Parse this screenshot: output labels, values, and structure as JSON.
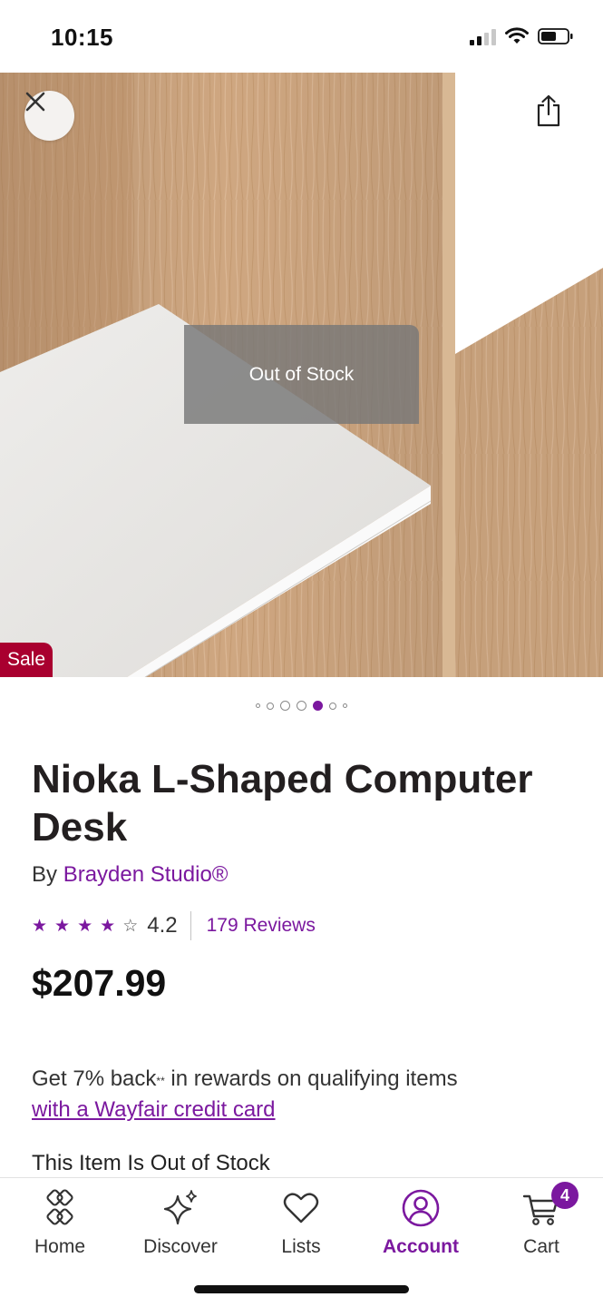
{
  "status_bar": {
    "time": "10:15"
  },
  "hero": {
    "overlay_text": "Out of Stock",
    "sale_badge": "Sale",
    "close_icon": "close-icon",
    "share_icon": "share-icon",
    "carousel": {
      "count": 7,
      "active_index": 4
    }
  },
  "product": {
    "title": "Nioka L-Shaped Computer Desk",
    "by_label": "By",
    "brand": "Brayden Studio®",
    "rating": "4.2",
    "rating_value": 4.2,
    "reviews": "179 Reviews",
    "price": "$207.99",
    "rewards_text": "Get 7% back",
    "rewards_mark": "**",
    "rewards_suffix": " in rewards on qualifying items",
    "rewards_link": "with a Wayfair credit card",
    "stock_note": "This Item Is Out of Stock"
  },
  "nav": {
    "items": [
      {
        "label": "Home",
        "icon": "home-icon"
      },
      {
        "label": "Discover",
        "icon": "sparkle-icon"
      },
      {
        "label": "Lists",
        "icon": "heart-icon"
      },
      {
        "label": "Account",
        "icon": "account-icon",
        "active": true
      },
      {
        "label": "Cart",
        "icon": "cart-icon",
        "badge": "4"
      }
    ]
  },
  "colors": {
    "accent": "#7b189f",
    "sale": "#a9002f"
  }
}
